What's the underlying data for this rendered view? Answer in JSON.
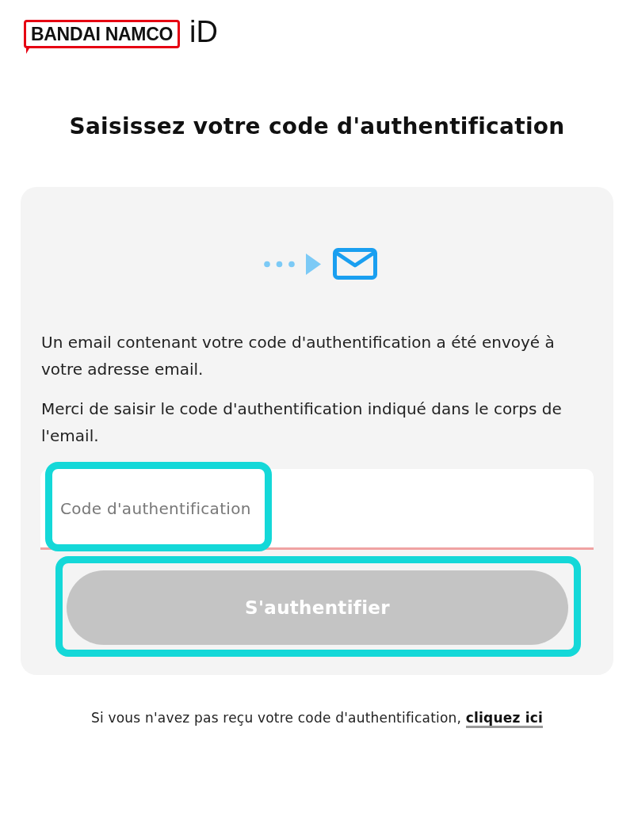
{
  "header": {
    "logo": "BANDAI NAMCO",
    "suffix": "iD"
  },
  "title": "Saisissez votre code d'authentification",
  "card": {
    "messages": [
      "Un email contenant votre code d'authentification a été envoyé à votre adresse email.",
      "Merci de saisir le code d'authentification indiqué dans le corps de l'email."
    ],
    "code_field": {
      "placeholder": "Code d'authentification",
      "invalid": true,
      "highlighted": true
    },
    "submit_button": {
      "label": "S'authentifier",
      "disabled": true,
      "highlighted": true
    }
  },
  "footer": {
    "text": "Si vous n'avez pas reçu votre code d'authentification,",
    "link": "cliquez ici"
  }
}
